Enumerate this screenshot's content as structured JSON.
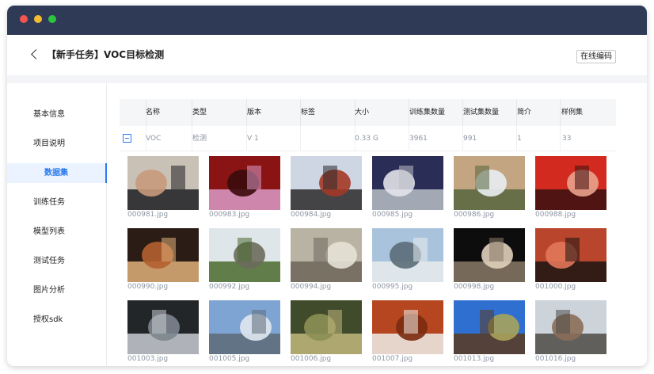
{
  "header": {
    "title": "【新手任务】VOC目标检测",
    "edit_label": "在线编码"
  },
  "sidebar": {
    "items": [
      {
        "label": "基本信息"
      },
      {
        "label": "项目说明"
      },
      {
        "label": "数据集",
        "active": true
      },
      {
        "label": "训练任务"
      },
      {
        "label": "模型列表"
      },
      {
        "label": "测试任务"
      },
      {
        "label": "图片分析"
      },
      {
        "label": "授权sdk"
      }
    ]
  },
  "table": {
    "columns": [
      "名称",
      "类型",
      "版本",
      "标签",
      "大小",
      "训练集数量",
      "测试集数量",
      "简介",
      "样例集"
    ],
    "row": {
      "name": "VOC",
      "type": "检测",
      "version": "V 1",
      "tags": "",
      "size": "0.33 G",
      "train_count": "3961",
      "test_count": "991",
      "intro": "1",
      "sample_count": "33"
    }
  },
  "samples": [
    {
      "file": "000981.jpg",
      "palette": [
        "#c9c1b5",
        "#1d1f23",
        "#c89a7c"
      ]
    },
    {
      "file": "000983.jpg",
      "palette": [
        "#8a1414",
        "#d99ac8",
        "#3b0b0b"
      ]
    },
    {
      "file": "000984.jpg",
      "palette": [
        "#cfd6e3",
        "#2c2a2c",
        "#a33826"
      ]
    },
    {
      "file": "000985.jpg",
      "palette": [
        "#2a2e56",
        "#b9bdc6",
        "#e2e2ea"
      ]
    },
    {
      "file": "000986.jpg",
      "palette": [
        "#c4a582",
        "#56653e",
        "#e9edf2"
      ]
    },
    {
      "file": "000988.jpg",
      "palette": [
        "#d22a1e",
        "#3a1010",
        "#e9a28d"
      ]
    },
    {
      "file": "000990.jpg",
      "palette": [
        "#2b1d15",
        "#e0b07a",
        "#b4612f"
      ]
    },
    {
      "file": "000992.jpg",
      "palette": [
        "#dfe6ea",
        "#4b6a2e",
        "#6b6b5c"
      ]
    },
    {
      "file": "000994.jpg",
      "palette": [
        "#b9b3a4",
        "#6e655b",
        "#e5e1d6"
      ]
    },
    {
      "file": "000995.jpg",
      "palette": [
        "#aac3dc",
        "#e8ecef",
        "#5b6d78"
      ]
    },
    {
      "file": "000998.jpg",
      "palette": [
        "#0d0d0e",
        "#8a7a66",
        "#e0d0bb"
      ]
    },
    {
      "file": "001000.jpg",
      "palette": [
        "#b8452c",
        "#1b1413",
        "#e2775a"
      ]
    },
    {
      "file": "001003.jpg",
      "palette": [
        "#232628",
        "#c8ccd2",
        "#7d858e"
      ]
    },
    {
      "file": "001005.jpg",
      "palette": [
        "#7ea4d4",
        "#5c6b77",
        "#e1e8ef"
      ]
    },
    {
      "file": "001006.jpg",
      "palette": [
        "#3f4b2a",
        "#c2b87d",
        "#8c8f55"
      ]
    },
    {
      "file": "001007.jpg",
      "palette": [
        "#b5461f",
        "#eeeeea",
        "#7a2a10"
      ]
    },
    {
      "file": "001013.jpg",
      "palette": [
        "#2f6fd0",
        "#5a3a1f",
        "#a8a35b"
      ]
    },
    {
      "file": "001016.jpg",
      "palette": [
        "#cdd3db",
        "#4e4a45",
        "#8a6e58"
      ]
    }
  ]
}
